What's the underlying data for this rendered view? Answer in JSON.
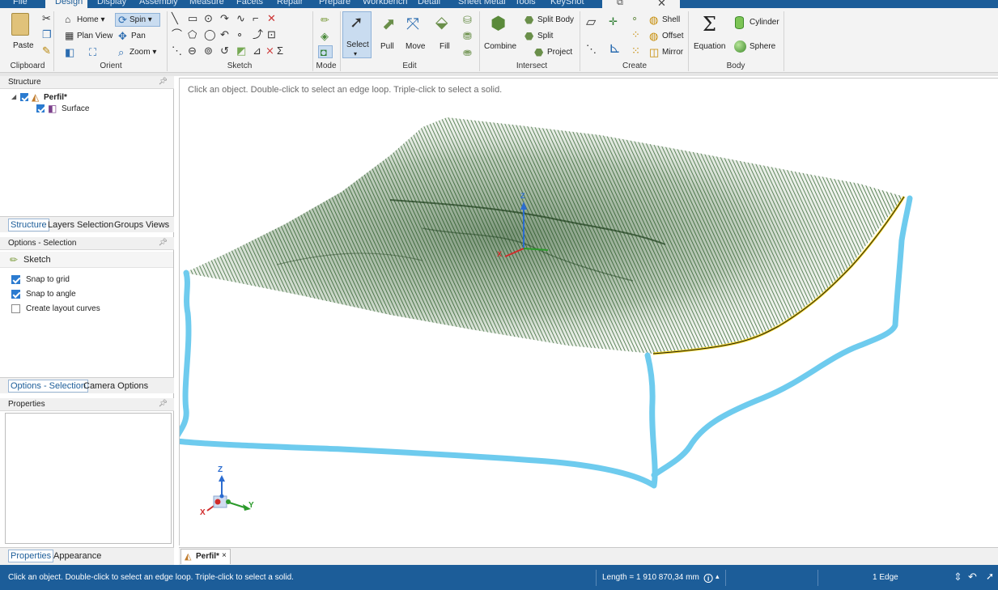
{
  "menu": {
    "tabs": [
      "File",
      "Design",
      "Display",
      "Assembly",
      "Measure",
      "Facets",
      "Repair",
      "Prepare",
      "Workbench",
      "Detail",
      "Sheet Metal",
      "Tools",
      "KeyShot"
    ],
    "active": "Design"
  },
  "ribbon": {
    "clipboard": {
      "paste": "Paste",
      "label": "Clipboard"
    },
    "orient": {
      "home": "Home ▾",
      "spin": "Spin ▾",
      "plan_view": "Plan View",
      "pan": "Pan",
      "zoom": "Zoom ▾",
      "label": "Orient"
    },
    "sketch": {
      "label": "Sketch"
    },
    "mode": {
      "label": "Mode"
    },
    "edit": {
      "select": "Select",
      "pull": "Pull",
      "move": "Move",
      "fill": "Fill",
      "label": "Edit"
    },
    "intersect": {
      "combine": "Combine",
      "split_body": "Split Body",
      "split": "Split",
      "project": "Project",
      "label": "Intersect"
    },
    "create": {
      "shell": "Shell",
      "offset": "Offset",
      "mirror": "Mirror",
      "label": "Create"
    },
    "body": {
      "equation": "Equation",
      "cylinder": "Cylinder",
      "sphere": "Sphere",
      "label": "Body"
    }
  },
  "structure": {
    "title": "Structure",
    "root": "Perfil*",
    "child": "Surface",
    "tabs": [
      "Structure",
      "Layers",
      "Selection",
      "Groups",
      "Views"
    ]
  },
  "options": {
    "title": "Options - Selection",
    "sketch": "Sketch",
    "items": [
      {
        "label": "Snap to grid",
        "checked": true
      },
      {
        "label": "Snap to angle",
        "checked": true
      },
      {
        "label": "Create layout curves",
        "checked": false
      }
    ],
    "tabs": [
      "Options - Selection",
      "Camera Options"
    ]
  },
  "properties": {
    "title": "Properties",
    "tabs": [
      "Properties",
      "Appearance"
    ]
  },
  "viewport": {
    "hint": "Click an object. Double-click to select an edge loop. Triple-click to select a solid.",
    "axes": {
      "x": "X",
      "y": "Y",
      "z": "Z"
    },
    "doc_tab": "Perfil*",
    "doc_tab_close": "×"
  },
  "status": {
    "message": "Click an object. Double-click to select an edge loop. Triple-click to select a solid.",
    "length": "Length = 1 910 870,34 mm",
    "selection": "1 Edge"
  },
  "colors": {
    "accent": "#1c5d99",
    "terrain": "#3c6b3a",
    "annotation": "#6ecbee",
    "edge_highlight": "#f2d21b"
  }
}
